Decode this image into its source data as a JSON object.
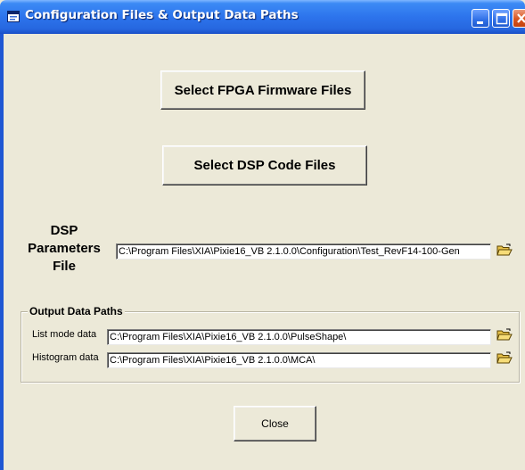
{
  "window": {
    "title": "Configuration Files & Output Data Paths",
    "icon": "app-window-icon",
    "controls": [
      "minimize-icon",
      "maximize-icon",
      "close-window-icon"
    ]
  },
  "buttons": {
    "fpga": "Select FPGA Firmware Files",
    "dsp_code": "Select DSP Code Files",
    "close": "Close"
  },
  "dsp_parameters": {
    "label": "DSP Parameters File",
    "value": "C:\\Program Files\\XIA\\Pixie16_VB 2.1.0.0\\Configuration\\Test_RevF14-100-Gen",
    "browse_icon": "open-folder-icon"
  },
  "output_paths": {
    "group_title": "Output Data Paths",
    "list_mode": {
      "label": "List mode data",
      "value": "C:\\Program Files\\XIA\\Pixie16_VB 2.1.0.0\\PulseShape\\",
      "browse_icon": "open-folder-icon"
    },
    "histogram": {
      "label": "Histogram data",
      "value": "C:\\Program Files\\XIA\\Pixie16_VB 2.1.0.0\\MCA\\",
      "browse_icon": "open-folder-icon"
    }
  },
  "colors": {
    "titlebar": "#2667e0",
    "face": "#ece9d8",
    "close_button": "#d8541f"
  }
}
